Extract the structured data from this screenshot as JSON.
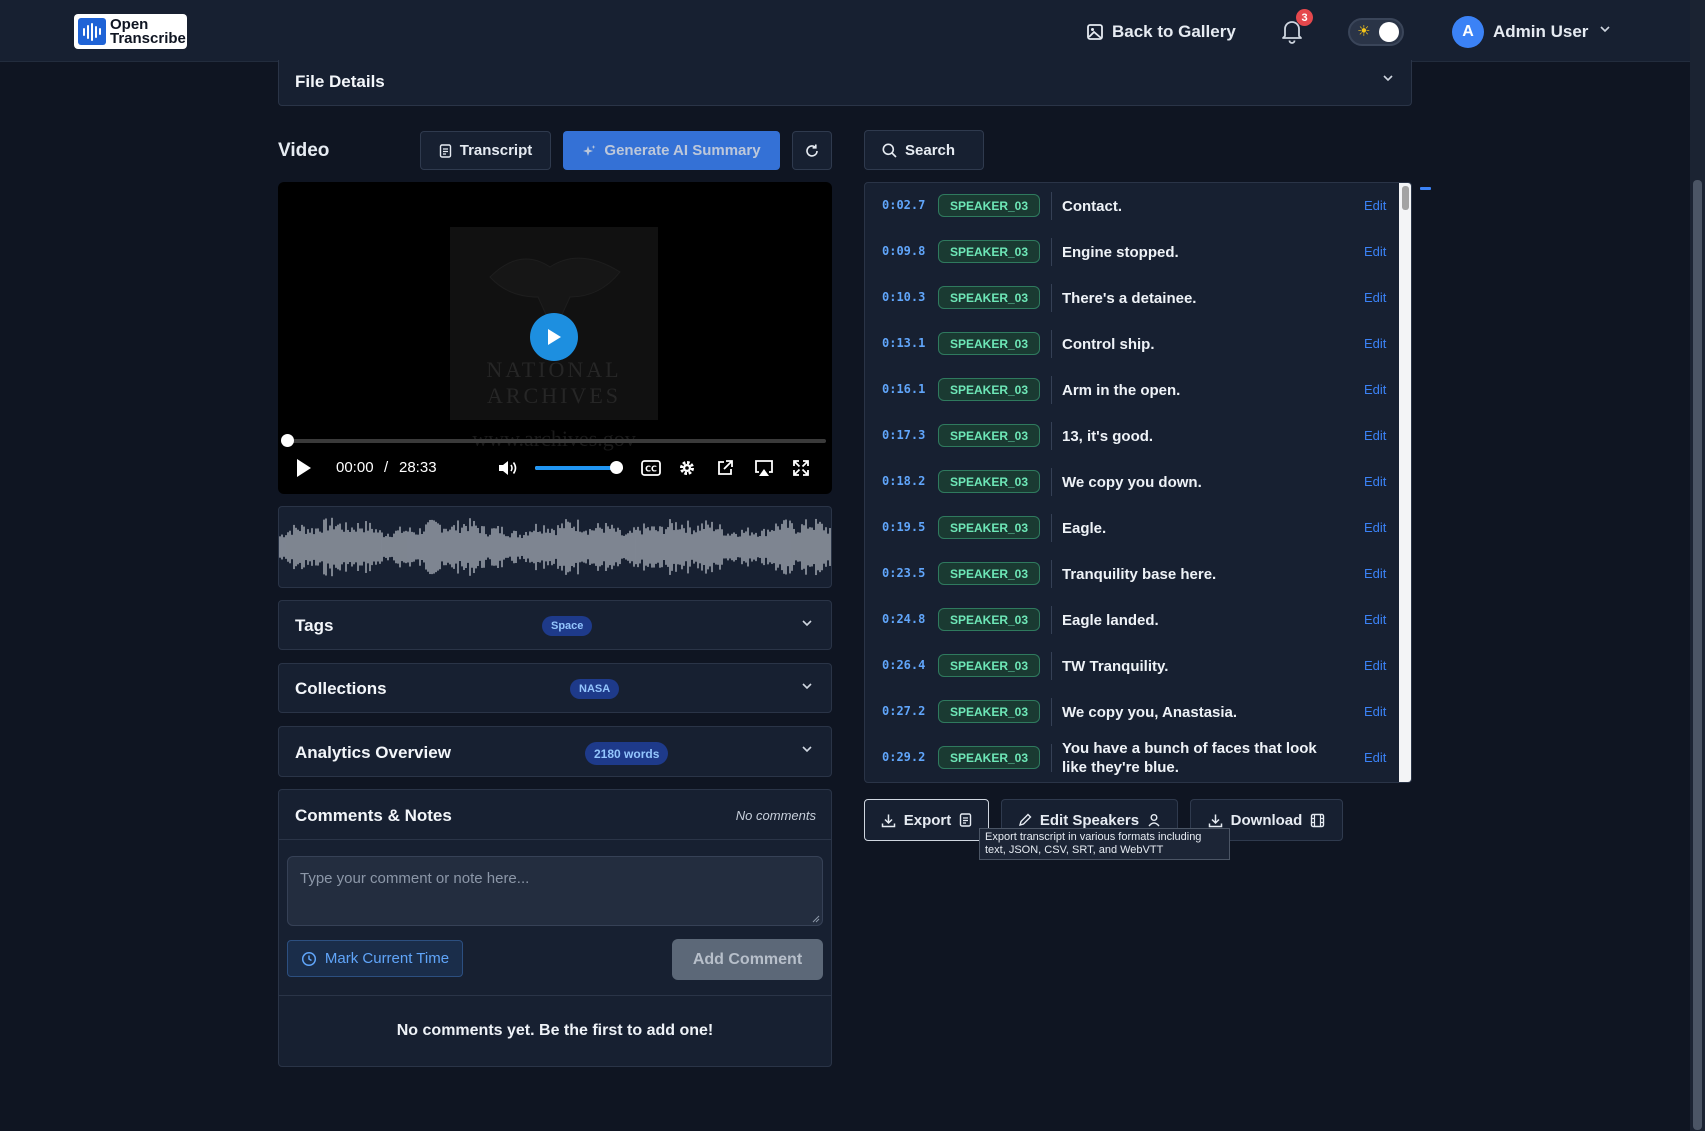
{
  "header": {
    "logo_line1": "Open",
    "logo_line2": "Transcribe",
    "back_to_gallery": "Back to Gallery",
    "notification_count": "3",
    "user_initial": "A",
    "user_name": "Admin User"
  },
  "file_details": {
    "title": "File Details"
  },
  "video_section": {
    "title": "Video",
    "transcript_button": "Transcript",
    "ai_summary_button": "Generate AI Summary",
    "current_time": "00:00",
    "time_separator": "/",
    "duration": "28:33",
    "volume_level": 0.92,
    "progress_fraction": 0,
    "poster_line1": "NATIONAL",
    "poster_line2": "ARCHIVES",
    "watermark": "www.archives.gov"
  },
  "tags": {
    "title": "Tags",
    "pill": "Space"
  },
  "collections": {
    "title": "Collections",
    "pill": "NASA"
  },
  "analytics": {
    "title": "Analytics Overview",
    "pill": "2180 words"
  },
  "comments": {
    "title": "Comments & Notes",
    "count_label": "No comments",
    "placeholder": "Type your comment or note here...",
    "mark_time_button": "Mark Current Time",
    "add_button": "Add Comment",
    "empty_message": "No comments yet. Be the first to add one!"
  },
  "transcript": {
    "search_label": "Search",
    "edit_label": "Edit",
    "rows": [
      {
        "time": "0:02.7",
        "speaker": "SPEAKER_03",
        "text": "Contact."
      },
      {
        "time": "0:09.8",
        "speaker": "SPEAKER_03",
        "text": "Engine stopped."
      },
      {
        "time": "0:10.3",
        "speaker": "SPEAKER_03",
        "text": "There's a detainee."
      },
      {
        "time": "0:13.1",
        "speaker": "SPEAKER_03",
        "text": "Control ship."
      },
      {
        "time": "0:16.1",
        "speaker": "SPEAKER_03",
        "text": "Arm in the open."
      },
      {
        "time": "0:17.3",
        "speaker": "SPEAKER_03",
        "text": "13, it's good."
      },
      {
        "time": "0:18.2",
        "speaker": "SPEAKER_03",
        "text": "We copy you down."
      },
      {
        "time": "0:19.5",
        "speaker": "SPEAKER_03",
        "text": "Eagle."
      },
      {
        "time": "0:23.5",
        "speaker": "SPEAKER_03",
        "text": "Tranquility base here."
      },
      {
        "time": "0:24.8",
        "speaker": "SPEAKER_03",
        "text": "Eagle landed."
      },
      {
        "time": "0:26.4",
        "speaker": "SPEAKER_03",
        "text": "TW Tranquility."
      },
      {
        "time": "0:27.2",
        "speaker": "SPEAKER_03",
        "text": "We copy you, Anastasia."
      },
      {
        "time": "0:29.2",
        "speaker": "SPEAKER_03",
        "text": "You have a bunch of faces that look like they're blue."
      }
    ],
    "export_button": "Export",
    "edit_speakers_button": "Edit Speakers",
    "download_button": "Download",
    "export_tooltip": "Export transcript in various formats including text, JSON, CSV, SRT, and WebVTT"
  },
  "colors": {
    "accent": "#3b82f6",
    "speaker_badge": "#6ee7b7",
    "notification": "#e5484d",
    "background": "#0f1522"
  }
}
